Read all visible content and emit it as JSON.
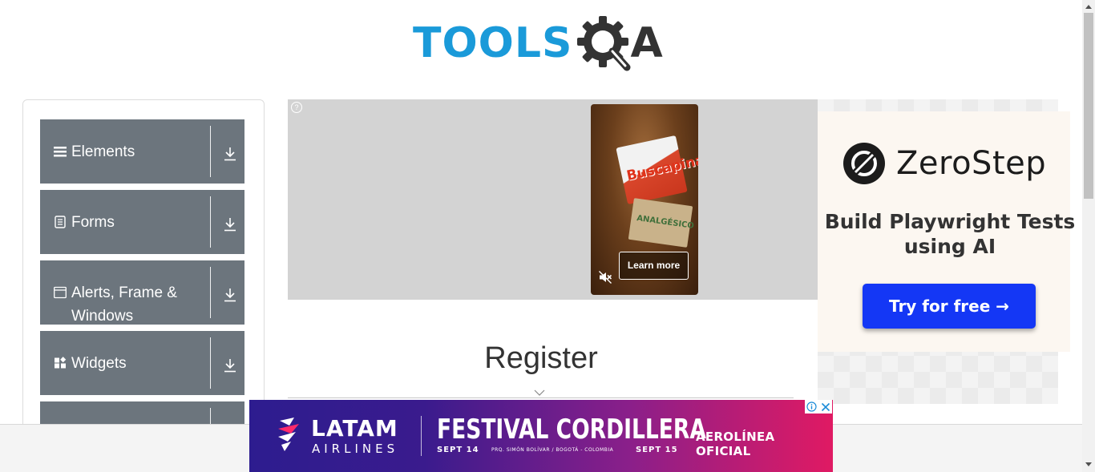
{
  "logo": {
    "tools_text": "TOOLS",
    "a_text": "A",
    "colors": {
      "tools": "#1a9ad9",
      "qa": "#333333"
    }
  },
  "sidebar": {
    "items": [
      {
        "label": "Elements",
        "icon": "hamburger-icon"
      },
      {
        "label": "Forms",
        "icon": "document-icon"
      },
      {
        "label": "Alerts, Frame & Windows",
        "icon": "window-icon"
      },
      {
        "label": "Widgets",
        "icon": "widgets-icon"
      },
      {
        "label": "",
        "icon": ""
      }
    ],
    "background": "#6c757d"
  },
  "center_ad": {
    "help_glyph": "?",
    "brand": "Buscapina",
    "product_text": "ANALGÉSICO",
    "cta": "Learn more"
  },
  "right_ad": {
    "brand": "ZeroStep",
    "tagline": "Build Playwright Tests using AI",
    "cta": "Try for free →",
    "cta_color": "#1437f5"
  },
  "main": {
    "title": "Register"
  },
  "bottom_ad": {
    "brand": "LATAM",
    "brand_sub": "AIRLINES",
    "event": "FESTIVAL CORDILLERA",
    "date_left": "SEPT 14",
    "venue": "PRQ. SIMÓN BOLÍVAR / BOGOTÁ - COLOMBIA",
    "date_right": "SEPT 15",
    "official": "AEROLÍNEA OFICIAL"
  }
}
